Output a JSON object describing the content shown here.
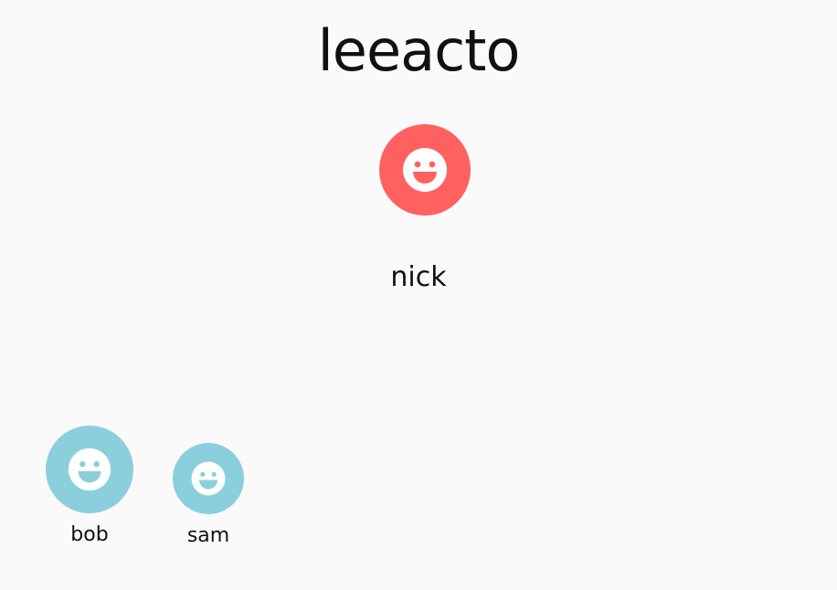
{
  "app": {
    "title": "leeacto"
  },
  "current_user": {
    "name": "nick",
    "avatar_icon": "smiley-face-icon",
    "color": "#ff6161"
  },
  "peers": [
    {
      "name": "bob",
      "avatar_icon": "smiley-face-icon",
      "color": "#8ccfdc"
    },
    {
      "name": "sam",
      "avatar_icon": "smiley-face-icon",
      "color": "#8ccfdc"
    }
  ],
  "colors": {
    "background": "#fafafb",
    "face": "#ffffff"
  }
}
